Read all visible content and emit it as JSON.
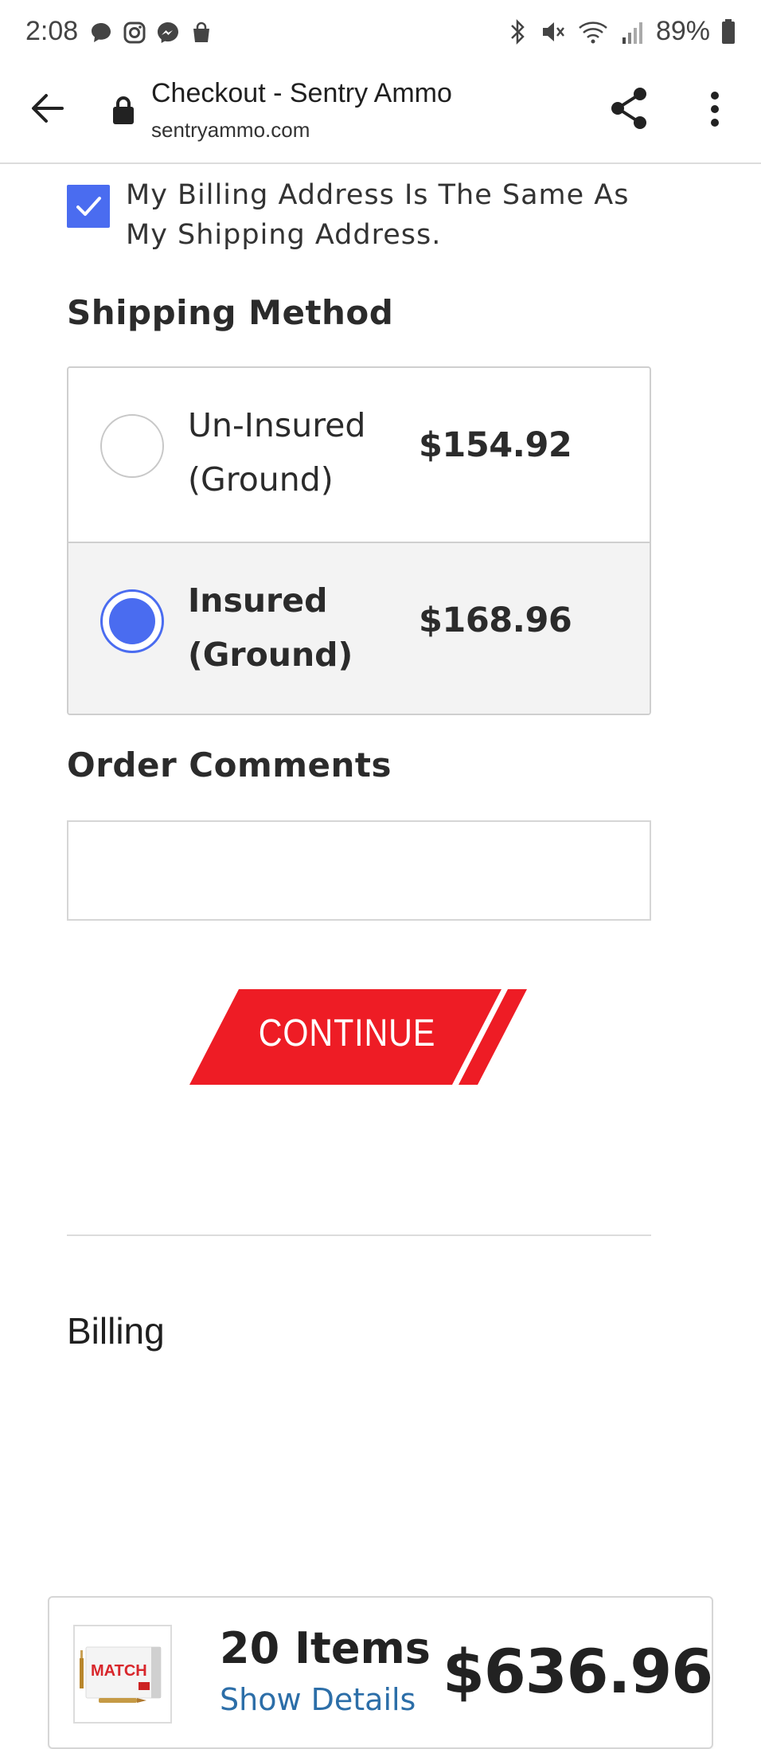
{
  "status_bar": {
    "time": "2:08",
    "battery": "89%",
    "left_icons": [
      "chat-bubble-icon",
      "instagram-icon",
      "messenger-icon",
      "shopping-bag-icon"
    ],
    "right_icons": [
      "bluetooth-icon",
      "mute-icon",
      "wifi-icon",
      "signal-icon",
      "battery-icon"
    ]
  },
  "browser": {
    "title": "Checkout - Sentry Ammo",
    "url": "sentryammo.com"
  },
  "billing_same": {
    "checked": true,
    "label": "My Billing Address Is The Same As My Shipping Address."
  },
  "shipping": {
    "title": "Shipping Method",
    "options": [
      {
        "label": "Un-Insured (Ground)",
        "price": "$154.92",
        "selected": false
      },
      {
        "label": "Insured (Ground)",
        "price": "$168.96",
        "selected": true
      }
    ]
  },
  "comments": {
    "title": "Order Comments",
    "value": "",
    "placeholder": ""
  },
  "continue_label": "CONTINUE",
  "billing_heading": "Billing",
  "summary": {
    "items": "20 Items",
    "show_details": "Show Details",
    "total": "$636.96",
    "product_box_text": "MATCH"
  },
  "colors": {
    "accent_blue": "#4a6cf0",
    "brand_red": "#ee1c25",
    "link_blue": "#2c6ea8"
  }
}
